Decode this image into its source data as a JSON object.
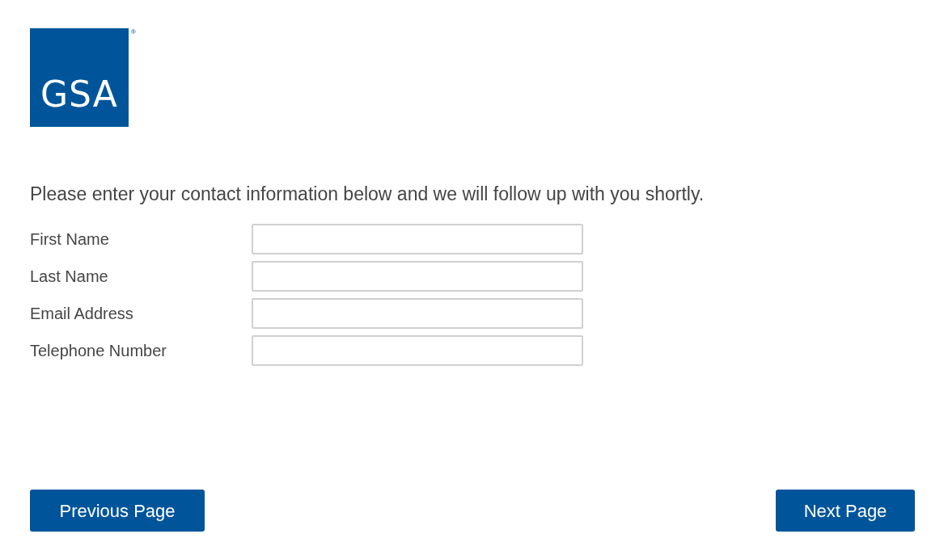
{
  "logo": {
    "text": "GSA",
    "mark": "®"
  },
  "intro": "Please enter your contact information below and we will follow up with you shortly.",
  "fields": [
    {
      "label": "First Name"
    },
    {
      "label": "Last Name"
    },
    {
      "label": "Email Address"
    },
    {
      "label": "Telephone Number"
    }
  ],
  "buttons": {
    "previous": "Previous Page",
    "next": "Next Page"
  }
}
